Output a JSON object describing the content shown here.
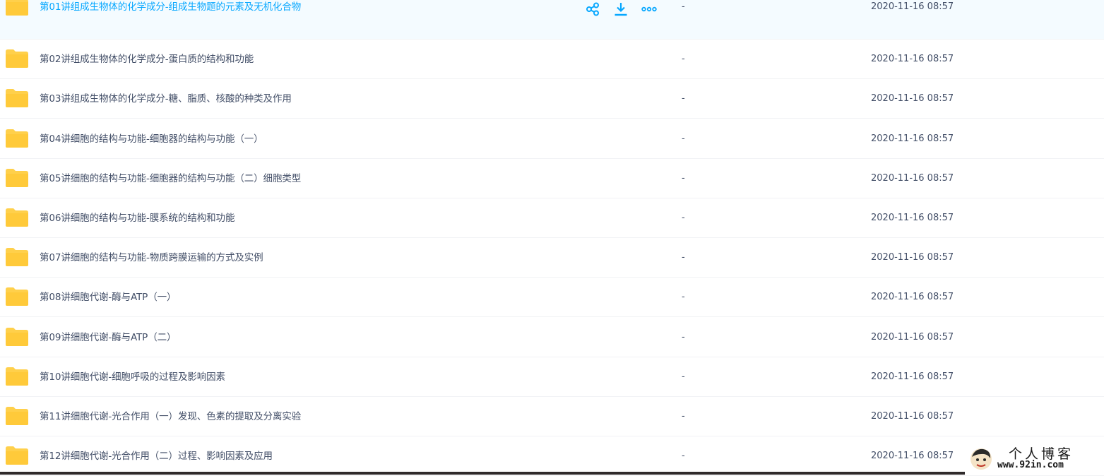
{
  "files": [
    {
      "name": "第01讲组成生物体的化学成分-组成生物题的元素及无机化合物",
      "size": "-",
      "date": "2020-11-16 08:57",
      "hovered": true
    },
    {
      "name": "第02讲组成生物体的化学成分-蛋白质的结构和功能",
      "size": "-",
      "date": "2020-11-16 08:57"
    },
    {
      "name": "第03讲组成生物体的化学成分-糖、脂质、核酸的种类及作用",
      "size": "-",
      "date": "2020-11-16 08:57"
    },
    {
      "name": "第04讲细胞的结构与功能-细胞器的结构与功能（一）",
      "size": "-",
      "date": "2020-11-16 08:57"
    },
    {
      "name": "第05讲细胞的结构与功能-细胞器的结构与功能（二）细胞类型",
      "size": "-",
      "date": "2020-11-16 08:57"
    },
    {
      "name": "第06讲细胞的结构与功能-膜系统的结构和功能",
      "size": "-",
      "date": "2020-11-16 08:57"
    },
    {
      "name": "第07讲细胞的结构与功能-物质跨膜运输的方式及实例",
      "size": "-",
      "date": "2020-11-16 08:57"
    },
    {
      "name": "第08讲细胞代谢-酶与ATP（一）",
      "size": "-",
      "date": "2020-11-16 08:57"
    },
    {
      "name": "第09讲细胞代谢-酶与ATP（二）",
      "size": "-",
      "date": "2020-11-16 08:57"
    },
    {
      "name": "第10讲细胞代谢-细胞呼吸的过程及影响因素",
      "size": "-",
      "date": "2020-11-16 08:57"
    },
    {
      "name": "第11讲细胞代谢-光合作用（一）发现、色素的提取及分离实验",
      "size": "-",
      "date": "2020-11-16 08:57"
    },
    {
      "name": "第12讲细胞代谢-光合作用（二）过程、影响因素及应用",
      "size": "-",
      "date": "2020-11-16 08:57"
    }
  ],
  "row_actions": [
    {
      "icon": "share-icon"
    },
    {
      "icon": "download-icon"
    },
    {
      "icon": "more-icon"
    }
  ],
  "colors": {
    "accent": "#06a7ff",
    "text": "#424e67",
    "folder": "#ffd04b",
    "hover_bg": "#f4fbff"
  },
  "watermark": {
    "title": "个人博客",
    "url": "www.92in.com"
  }
}
